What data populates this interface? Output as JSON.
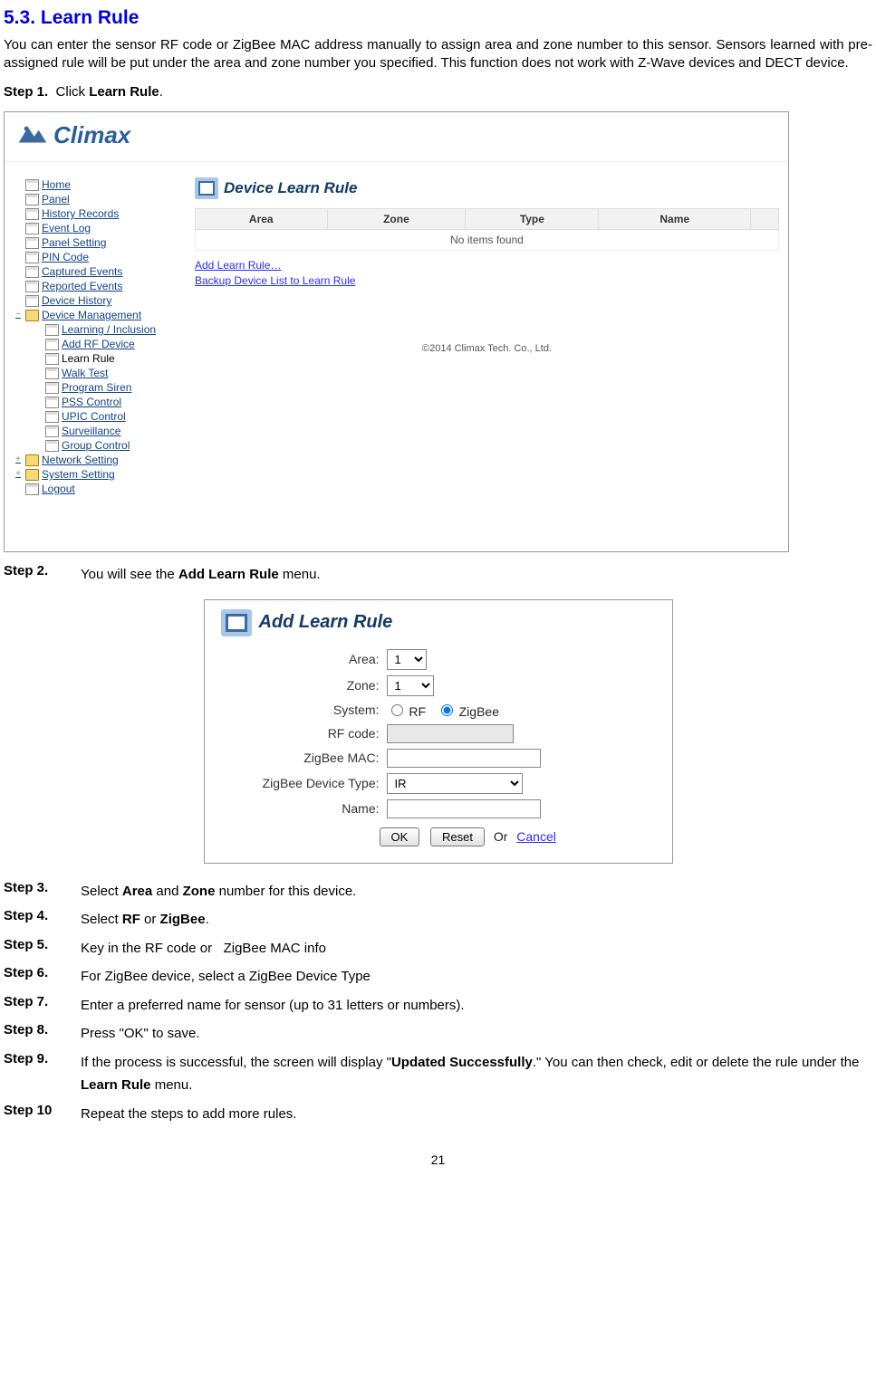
{
  "section_title": "5.3. Learn Rule",
  "intro": "You can enter the sensor RF code or ZigBee MAC address manually to assign area and zone number to this sensor. Sensors learned with pre-assigned rule will be put under the area and zone number you specified. This function does not work with Z-Wave devices and DECT device.",
  "step1": {
    "label": "Step 1.",
    "pre": "Click ",
    "bold": "Learn Rule",
    "post": "."
  },
  "fig1": {
    "logo": "Climax",
    "nav": [
      {
        "t": "Home",
        "lv": 0,
        "link": true,
        "ic": "p"
      },
      {
        "t": "Panel",
        "lv": 0,
        "link": true,
        "ic": "p"
      },
      {
        "t": "History Records",
        "lv": 0,
        "link": true,
        "ic": "p"
      },
      {
        "t": "Event Log",
        "lv": 0,
        "link": true,
        "ic": "p"
      },
      {
        "t": "Panel Setting",
        "lv": 0,
        "link": true,
        "ic": "p"
      },
      {
        "t": "PIN Code",
        "lv": 0,
        "link": true,
        "ic": "p"
      },
      {
        "t": "Captured Events",
        "lv": 0,
        "link": true,
        "ic": "p"
      },
      {
        "t": "Reported Events",
        "lv": 0,
        "link": true,
        "ic": "p"
      },
      {
        "t": "Device History",
        "lv": 0,
        "link": true,
        "ic": "p"
      },
      {
        "t": "Device Management",
        "lv": 0,
        "link": true,
        "ic": "f",
        "tw": "−"
      },
      {
        "t": "Learning / Inclusion",
        "lv": 1,
        "link": true,
        "ic": "p"
      },
      {
        "t": "Add RF Device",
        "lv": 1,
        "link": true,
        "ic": "p"
      },
      {
        "t": "Learn Rule",
        "lv": 1,
        "link": false,
        "ic": "p"
      },
      {
        "t": "Walk Test",
        "lv": 1,
        "link": true,
        "ic": "p"
      },
      {
        "t": "Program Siren",
        "lv": 1,
        "link": true,
        "ic": "p"
      },
      {
        "t": "PSS Control",
        "lv": 1,
        "link": true,
        "ic": "p"
      },
      {
        "t": "UPIC Control",
        "lv": 1,
        "link": true,
        "ic": "p"
      },
      {
        "t": "Surveillance",
        "lv": 1,
        "link": true,
        "ic": "p"
      },
      {
        "t": "Group Control",
        "lv": 1,
        "link": true,
        "ic": "p"
      },
      {
        "t": "Network Setting",
        "lv": 0,
        "link": true,
        "ic": "f",
        "tw": "+"
      },
      {
        "t": "System Setting",
        "lv": 0,
        "link": true,
        "ic": "f",
        "tw": "+"
      },
      {
        "t": "Logout",
        "lv": 0,
        "link": true,
        "ic": "p"
      }
    ],
    "panel_title": "Device Learn Rule",
    "cols": [
      "Area",
      "Zone",
      "Type",
      "Name"
    ],
    "empty": "No items found",
    "link1": "Add Learn Rule…",
    "link2": "Backup Device List to Learn Rule",
    "copyright": "©2014 Climax Tech. Co., Ltd."
  },
  "step2": {
    "label": "Step 2.",
    "pre": "You will see the ",
    "bold": "Add Learn Rule",
    "post": " menu."
  },
  "fig2": {
    "title": "Add Learn Rule",
    "labels": {
      "area": "Area:",
      "zone": "Zone:",
      "system": "System:",
      "rf": "RF code:",
      "mac": "ZigBee MAC:",
      "dtype": "ZigBee Device Type:",
      "name": "Name:"
    },
    "area_val": "1",
    "zone_val": "1",
    "rf_label": "RF",
    "zb_label": "ZigBee",
    "dtype_val": "IR",
    "ok": "OK",
    "reset": "Reset",
    "or": "Or",
    "cancel": "Cancel"
  },
  "steps_rest": [
    {
      "label": "Step 3.",
      "html": "Select <b>Area</b> and <b>Zone</b> number for this device."
    },
    {
      "label": "Step 4.",
      "html": "Select <b>RF</b> or <b>ZigBee</b>."
    },
    {
      "label": "Step 5.",
      "html": "Key in the RF code or&nbsp;&nbsp;&nbsp;ZigBee MAC info"
    },
    {
      "label": "Step 6.",
      "html": "For ZigBee device, select a ZigBee Device Type"
    },
    {
      "label": "Step 7.",
      "html": "Enter a preferred name for sensor (up to 31 letters or numbers)."
    },
    {
      "label": "Step 8.",
      "html": "Press \"OK\" to save."
    },
    {
      "label": "Step 9.",
      "html": "If the process is successful, the screen will display \"<b>Updated Successfully</b>.\" You can then check, edit or delete the rule under the <b>Learn Rule</b> menu."
    },
    {
      "label": "Step 10",
      "html": "Repeat the steps to add more rules."
    }
  ],
  "page_number": "21"
}
